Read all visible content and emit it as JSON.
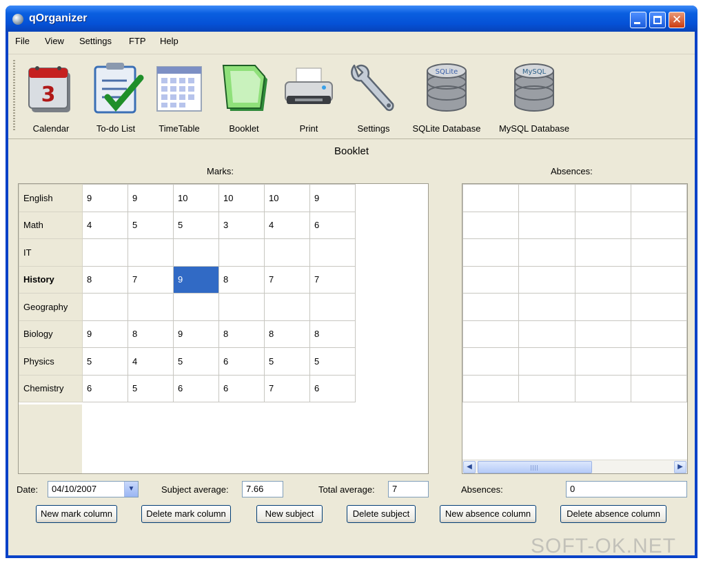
{
  "window": {
    "title": "qOrganizer"
  },
  "menu": [
    "File",
    "View",
    "Settings",
    "FTP",
    "Help"
  ],
  "toolbar": [
    {
      "label": "Calendar",
      "icon": "calendar-icon"
    },
    {
      "label": "To-do List",
      "icon": "todo-list-icon"
    },
    {
      "label": "TimeTable",
      "icon": "timetable-icon"
    },
    {
      "label": "Booklet",
      "icon": "booklet-icon"
    },
    {
      "label": "Print",
      "icon": "printer-icon"
    },
    {
      "label": "Settings",
      "icon": "wrench-icon"
    },
    {
      "label": "SQLite Database",
      "icon": "sqlite-database-icon"
    },
    {
      "label": "MySQL Database",
      "icon": "mysql-database-icon"
    }
  ],
  "icons": {
    "calendar_day": "3",
    "sqlite_text": "SQLite",
    "mysql_text": "MySQL"
  },
  "booklet": {
    "title": "Booklet",
    "marks_label": "Marks:",
    "absences_label": "Absences:",
    "subjects": [
      {
        "name": "English",
        "marks": [
          "9",
          "9",
          "10",
          "10",
          "10",
          "9"
        ]
      },
      {
        "name": "Math",
        "marks": [
          "4",
          "5",
          "5",
          "3",
          "4",
          "6"
        ]
      },
      {
        "name": "IT",
        "marks": [
          "",
          "",
          "",
          "",
          "",
          ""
        ]
      },
      {
        "name": "History",
        "marks": [
          "8",
          "7",
          "9",
          "8",
          "7",
          "7"
        ],
        "bold": true,
        "selected_col": 2
      },
      {
        "name": "Geography",
        "marks": [
          "",
          "",
          "",
          "",
          "",
          ""
        ]
      },
      {
        "name": "Biology",
        "marks": [
          "9",
          "8",
          "9",
          "8",
          "8",
          "8"
        ]
      },
      {
        "name": "Physics",
        "marks": [
          "5",
          "4",
          "5",
          "6",
          "5",
          "5"
        ]
      },
      {
        "name": "Chemistry",
        "marks": [
          "6",
          "5",
          "6",
          "6",
          "7",
          "6"
        ]
      }
    ]
  },
  "footer": {
    "date_label": "Date:",
    "date_value": "04/10/2007",
    "subject_average_label": "Subject average:",
    "subject_average_value": "7.66",
    "total_average_label": "Total average:",
    "total_average_value": "7",
    "absences_label": "Absences:",
    "absences_value": "0"
  },
  "buttons": {
    "new_mark_column": "New mark column",
    "delete_mark_column": "Delete mark column",
    "new_subject": "New subject",
    "delete_subject": "Delete subject",
    "new_absence_column": "New absence column",
    "delete_absence_column": "Delete absence column"
  },
  "watermark": "SOFT-OK.NET",
  "colors": {
    "titlebar": "#0551d6",
    "selection": "#316ac5",
    "window_bg": "#ece9d8"
  }
}
